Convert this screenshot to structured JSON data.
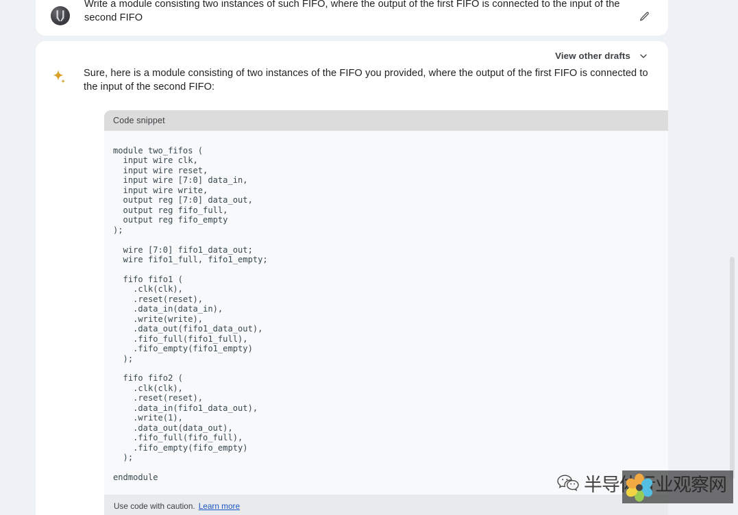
{
  "app": {
    "background_color": "#eef1f6",
    "card_color": "#ffffff"
  },
  "prompt": {
    "avatar_name": "user-avatar",
    "text": "Write a module consisting two instances of such FIFO, where the output of the first FIFO is connected to the input of the second FIFO",
    "edit_icon": "pencil-icon"
  },
  "response": {
    "drafts_label": "View other drafts",
    "drafts_chevron": "chevron-down-icon",
    "sparkle_icon": "sparkle-icon",
    "text": "Sure, here is a module consisting of two instances of the FIFO you provided, where the output of the first FIFO is connected to the input of the second FIFO:"
  },
  "code_snippet": {
    "header": "Code snippet",
    "language": "verilog",
    "code": "module two_fifos (\n  input wire clk,\n  input wire reset,\n  input wire [7:0] data_in,\n  input wire write,\n  output reg [7:0] data_out,\n  output reg fifo_full,\n  output reg fifo_empty\n);\n\n  wire [7:0] fifo1_data_out;\n  wire fifo1_full, fifo1_empty;\n\n  fifo fifo1 (\n    .clk(clk),\n    .reset(reset),\n    .data_in(data_in),\n    .write(write),\n    .data_out(fifo1_data_out),\n    .fifo_full(fifo1_full),\n    .fifo_empty(fifo1_empty)\n  );\n\n  fifo fifo2 (\n    .clk(clk),\n    .reset(reset),\n    .data_in(fifo1_data_out),\n    .write(1),\n    .data_out(data_out),\n    .fifo_full(fifo_full),\n    .fifo_empty(fifo_empty)\n  );\n\nendmodule",
    "caution_text": "Use code with caution.",
    "learn_more_label": "Learn more",
    "learn_more_color": "#1a56c4"
  },
  "scrollbar": {
    "name": "vertical-scrollbar",
    "thumb_color": "#dadce0"
  },
  "watermark": {
    "wechat_icon": "wechat-icon",
    "text": "半导体行业观察网",
    "flower_icon": "flower-logo-icon"
  }
}
